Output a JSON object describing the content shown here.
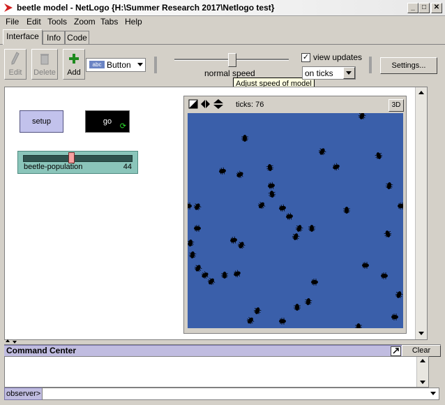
{
  "window": {
    "title": "beetle model - NetLogo {H:\\Summer Research 2017\\Netlogo test}",
    "icon": "netlogo-logo-icon",
    "controls": [
      "minimize",
      "maximize",
      "close"
    ]
  },
  "menu": [
    "File",
    "Edit",
    "Tools",
    "Zoom",
    "Tabs",
    "Help"
  ],
  "tabs": [
    {
      "label": "Interface",
      "active": true
    },
    {
      "label": "Info",
      "active": false
    },
    {
      "label": "Code",
      "active": false
    }
  ],
  "toolbar": {
    "edit_label": "Edit",
    "delete_label": "Delete",
    "add_label": "Add",
    "widget_type": "Button",
    "widget_icon_text": "abc",
    "speed_label": "normal speed",
    "speed_value": 0.5,
    "speed_tooltip": "Adjust speed of model",
    "view_updates_label": "view updates",
    "view_updates_checked": true,
    "update_mode": "on ticks",
    "settings_label": "Settings..."
  },
  "widgets": {
    "setup_label": "setup",
    "go_label": "go",
    "slider_name": "beetle-population",
    "slider_value": "44",
    "slider_fraction": 0.44
  },
  "view": {
    "ticks_label": "ticks: 76",
    "three_d_label": "3D",
    "background_color": "#3a5faa",
    "turtle_color": "#000000"
  },
  "command_center": {
    "title": "Command Center",
    "clear_label": "Clear",
    "agent_label": "observer>",
    "input_value": ""
  },
  "colors": {
    "button_bg": "#c2c2ec",
    "slider_bg": "#8ac5ba",
    "forever_icon": "#2bdc2b",
    "command_center_bg": "#c0bce0"
  }
}
